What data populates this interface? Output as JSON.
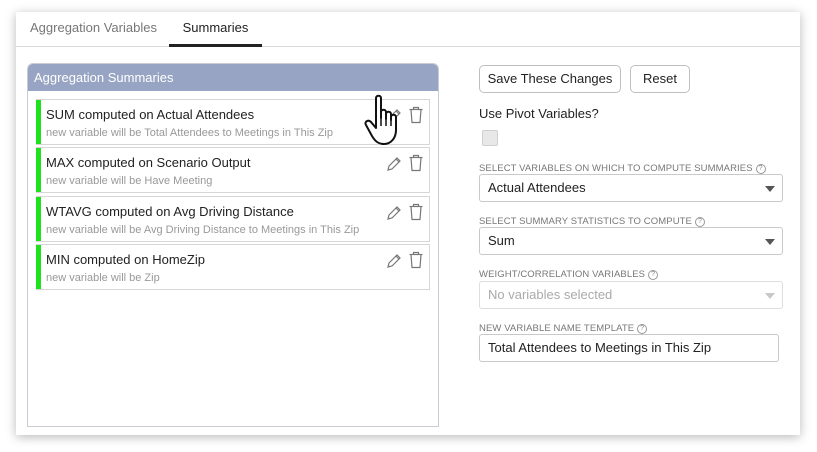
{
  "tabs": [
    {
      "label": "Aggregation Variables"
    },
    {
      "label": "Summaries"
    }
  ],
  "panel": {
    "title": "Aggregation Summaries",
    "items": [
      {
        "title": "SUM computed on Actual Attendees",
        "subtitle": "new variable will be Total Attendees to Meetings in This Zip"
      },
      {
        "title": "MAX computed on Scenario Output",
        "subtitle": "new variable will be Have Meeting"
      },
      {
        "title": "WTAVG computed on Avg Driving Distance",
        "subtitle": "new variable will be Avg Driving Distance to Meetings in This Zip"
      },
      {
        "title": "MIN computed on HomeZip",
        "subtitle": "new variable will be Zip"
      }
    ]
  },
  "buttons": {
    "save": "Save These Changes",
    "reset": "Reset"
  },
  "pivot": {
    "label": "Use Pivot Variables?",
    "checked": false
  },
  "fields": {
    "variables": {
      "label": "SELECT VARIABLES ON WHICH TO COMPUTE SUMMARIES",
      "value": "Actual Attendees"
    },
    "statistics": {
      "label": "SELECT SUMMARY STATISTICS TO COMPUTE",
      "value": "Sum"
    },
    "weight": {
      "label": "WEIGHT/CORRELATION VARIABLES",
      "placeholder": "No variables selected"
    },
    "template": {
      "label": "NEW VARIABLE NAME TEMPLATE",
      "value": "Total Attendees to Meetings in This Zip"
    }
  },
  "icons": {
    "help": "?",
    "edit": "pencil-icon",
    "delete": "trash-icon",
    "caret": "chevron-down-icon"
  },
  "colors": {
    "panel_header": "#97a4c3",
    "item_accent": "#1ee21e"
  }
}
